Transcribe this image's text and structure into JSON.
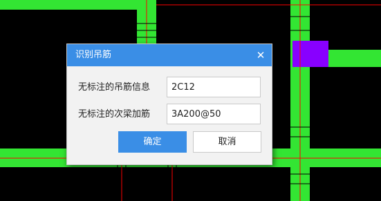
{
  "dialog": {
    "title": "识别吊筋",
    "close_glyph": "✕",
    "fields": [
      {
        "label": "无标注的吊筋信息",
        "value": "2C12"
      },
      {
        "label": "无标注的次梁加筋",
        "value": "3A200@50"
      }
    ],
    "ok_label": "确定",
    "cancel_label": "取消"
  },
  "colors": {
    "canvas_background": "#000000",
    "beam_green": "#33e533",
    "axis_red": "#ff0000",
    "column_purple": "#8800ff",
    "dialog_title_bar": "#3a8ee6",
    "ok_button": "#3a8ee6"
  }
}
